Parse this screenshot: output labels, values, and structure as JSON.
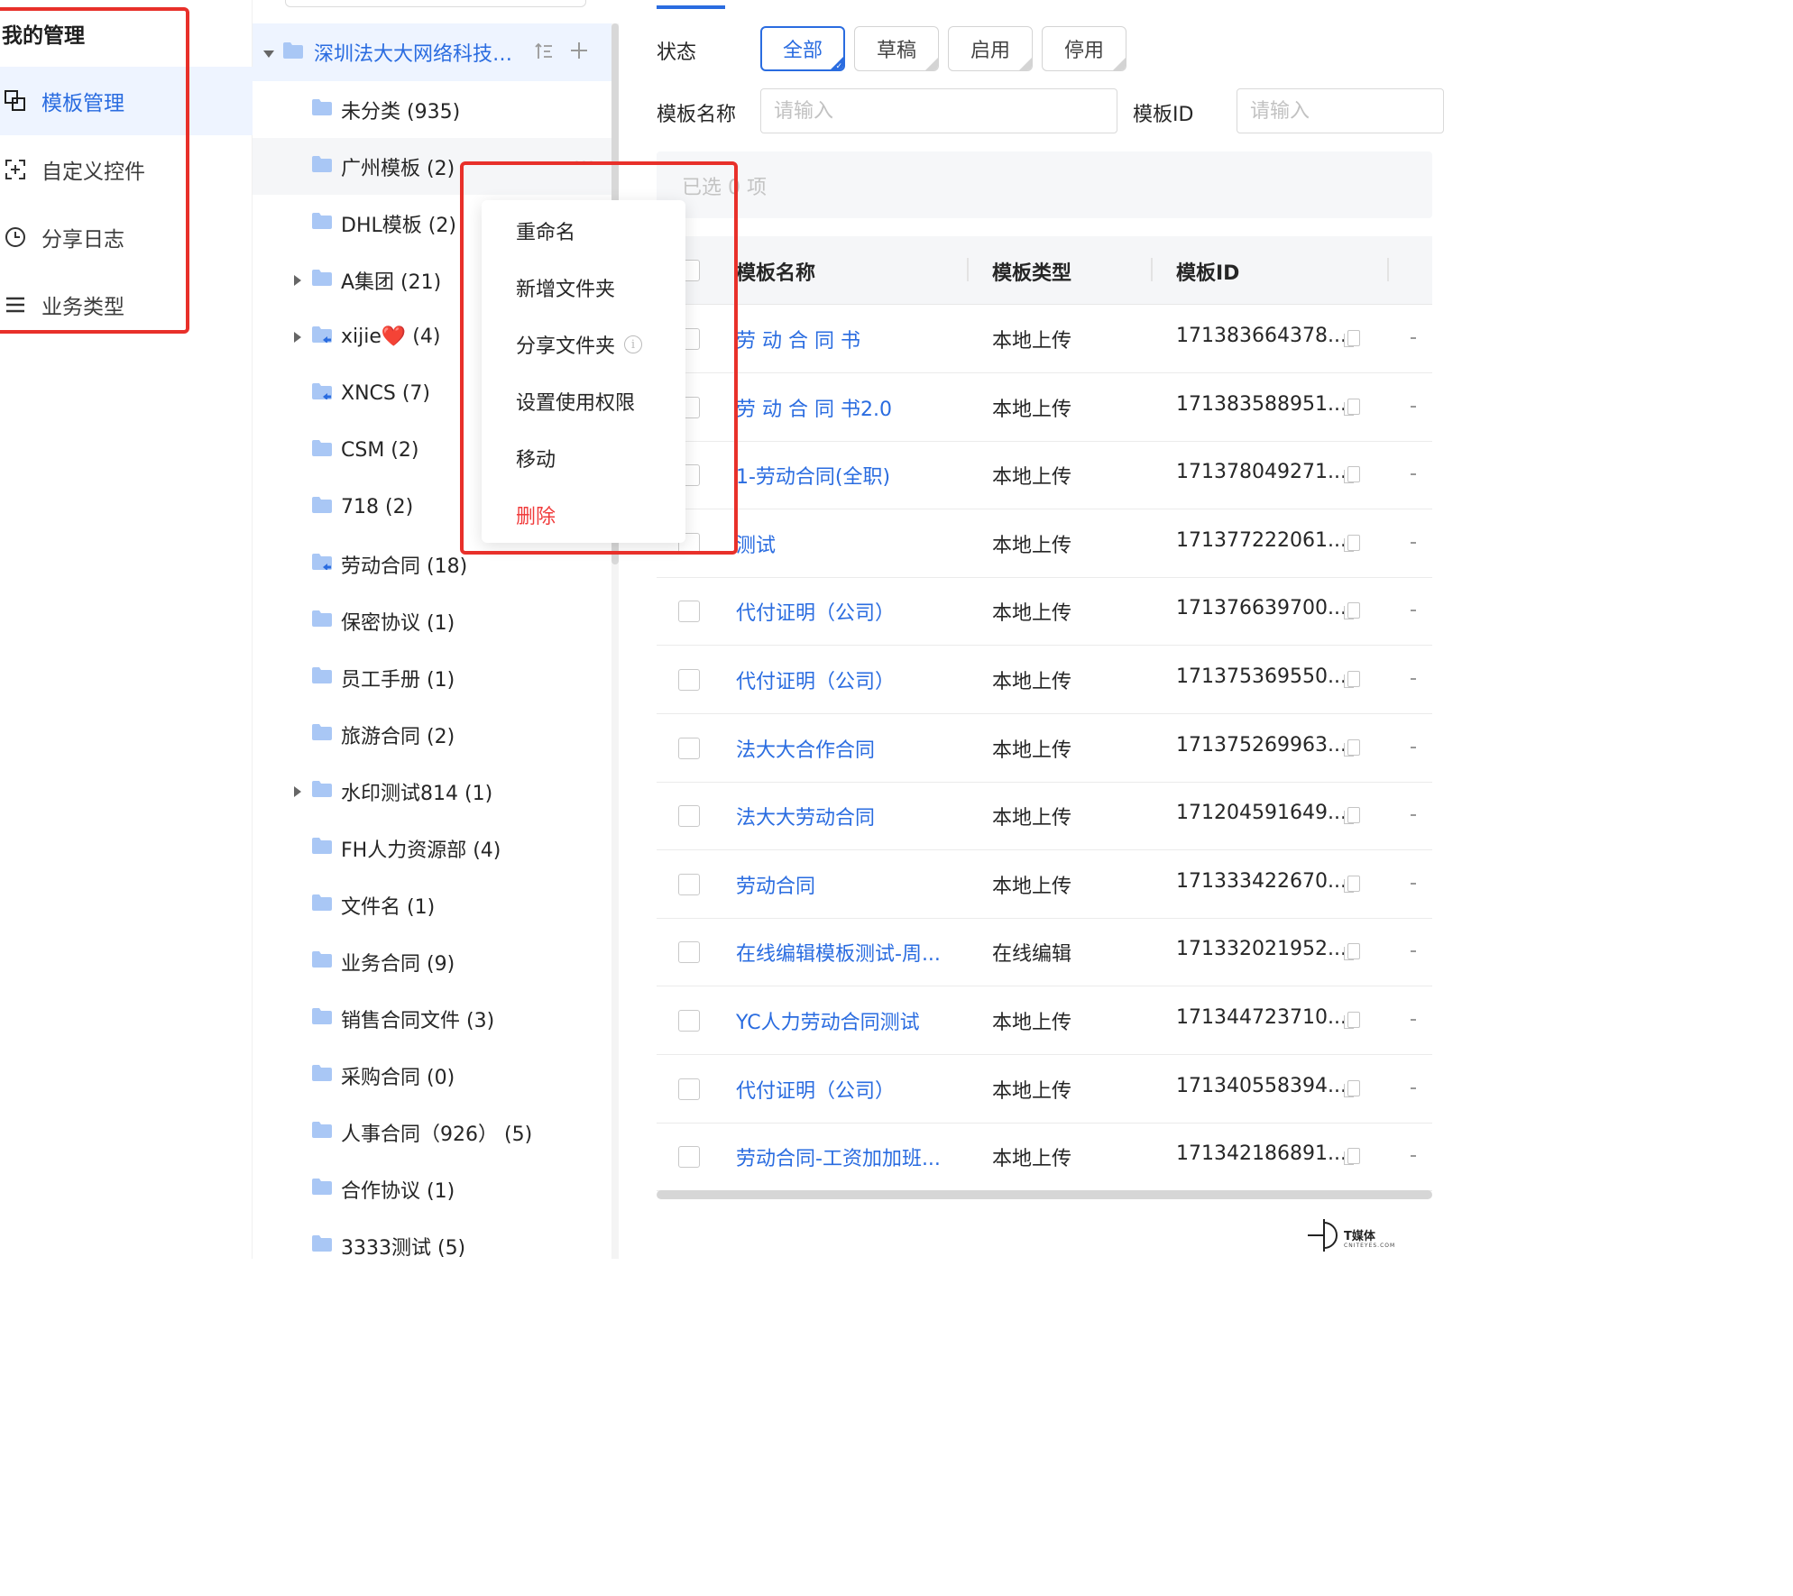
{
  "colors": {
    "accent": "#2a6ce0",
    "danger": "#f03b3b",
    "highlight_box": "#e8302a",
    "folder": "#a9c7f5"
  },
  "nav": {
    "title": "我的管理",
    "items": [
      {
        "label": "模板管理",
        "icon": "template-manage-icon",
        "active": true
      },
      {
        "label": "自定义控件",
        "icon": "custom-widget-icon",
        "active": false
      },
      {
        "label": "分享日志",
        "icon": "clock-icon",
        "active": false
      },
      {
        "label": "业务类型",
        "icon": "list-icon",
        "active": false
      }
    ]
  },
  "tree": {
    "root": {
      "label": "深圳法大大网络科技有...",
      "icons": [
        "sort-icon",
        "plus-icon"
      ]
    },
    "more_label": "···",
    "folders": [
      {
        "label": "未分类 (935)",
        "expandable": false,
        "shared": false
      },
      {
        "label": "广州模板 (2)",
        "expandable": false,
        "shared": false
      },
      {
        "label": "DHL模板 (2)",
        "expandable": false,
        "shared": false
      },
      {
        "label": "A集团 (21)",
        "expandable": true,
        "shared": false
      },
      {
        "label": "xijie❤️ (4)",
        "expandable": true,
        "shared": true
      },
      {
        "label": "XNCS (7)",
        "expandable": false,
        "shared": true
      },
      {
        "label": "CSM (2)",
        "expandable": false,
        "shared": false
      },
      {
        "label": "718 (2)",
        "expandable": false,
        "shared": false
      },
      {
        "label": "劳动合同 (18)",
        "expandable": false,
        "shared": true
      },
      {
        "label": "保密协议 (1)",
        "expandable": false,
        "shared": false
      },
      {
        "label": "员工手册 (1)",
        "expandable": false,
        "shared": false
      },
      {
        "label": "旅游合同 (2)",
        "expandable": false,
        "shared": false
      },
      {
        "label": "水印测试814 (1)",
        "expandable": true,
        "shared": false
      },
      {
        "label": "FH人力资源部 (4)",
        "expandable": false,
        "shared": false
      },
      {
        "label": "文件名 (1)",
        "expandable": false,
        "shared": false
      },
      {
        "label": "业务合同 (9)",
        "expandable": false,
        "shared": false
      },
      {
        "label": "销售合同文件 (3)",
        "expandable": false,
        "shared": false
      },
      {
        "label": "采购合同 (0)",
        "expandable": false,
        "shared": false
      },
      {
        "label": "人事合同（926） (5)",
        "expandable": false,
        "shared": false
      },
      {
        "label": "合作协议 (1)",
        "expandable": false,
        "shared": false
      },
      {
        "label": "3333测试 (5)",
        "expandable": false,
        "shared": false
      }
    ]
  },
  "context_menu": {
    "items": [
      {
        "label": "重命名",
        "danger": false,
        "info": false
      },
      {
        "label": "新增文件夹",
        "danger": false,
        "info": false
      },
      {
        "label": "分享文件夹",
        "danger": false,
        "info": true
      },
      {
        "label": "设置使用权限",
        "danger": false,
        "info": false
      },
      {
        "label": "移动",
        "danger": false,
        "info": false
      },
      {
        "label": "删除",
        "danger": true,
        "info": false
      }
    ],
    "info_glyph": "i"
  },
  "filters": {
    "status_label": "状态",
    "status_options": [
      "全部",
      "草稿",
      "启用",
      "停用"
    ],
    "status_selected": "全部",
    "name_label": "模板名称",
    "name_placeholder": "请输入",
    "id_label": "模板ID",
    "id_placeholder": "请输入"
  },
  "selection": {
    "text": "已选 0 项"
  },
  "table": {
    "columns": [
      "模板名称",
      "模板类型",
      "模板ID"
    ],
    "rows": [
      {
        "name": "劳 动 合 同 书",
        "type": "本地上传",
        "id": "171383664378..."
      },
      {
        "name": "劳 动 合 同 书2.0",
        "type": "本地上传",
        "id": "171383588951..."
      },
      {
        "name": "1-劳动合同(全职)",
        "type": "本地上传",
        "id": "171378049271..."
      },
      {
        "name": "测试",
        "type": "本地上传",
        "id": "171377222061..."
      },
      {
        "name": "代付证明（公司）",
        "type": "本地上传",
        "id": "171376639700..."
      },
      {
        "name": "代付证明（公司）",
        "type": "本地上传",
        "id": "171375369550..."
      },
      {
        "name": "法大大合作合同",
        "type": "本地上传",
        "id": "171375269963..."
      },
      {
        "name": "法大大劳动合同",
        "type": "本地上传",
        "id": "171204591649..."
      },
      {
        "name": "劳动合同",
        "type": "本地上传",
        "id": "171333422670..."
      },
      {
        "name": "在线编辑模板测试-周...",
        "type": "在线编辑",
        "id": "171332021952..."
      },
      {
        "name": "YC人力劳动合同测试",
        "type": "本地上传",
        "id": "171344723710..."
      },
      {
        "name": "代付证明（公司）",
        "type": "本地上传",
        "id": "171340558394..."
      },
      {
        "name": "劳动合同-工资加加班...",
        "type": "本地上传",
        "id": "171342186891..."
      }
    ]
  },
  "watermark": {
    "title": "T媒体",
    "subtitle": "CNITEYES.COM"
  }
}
